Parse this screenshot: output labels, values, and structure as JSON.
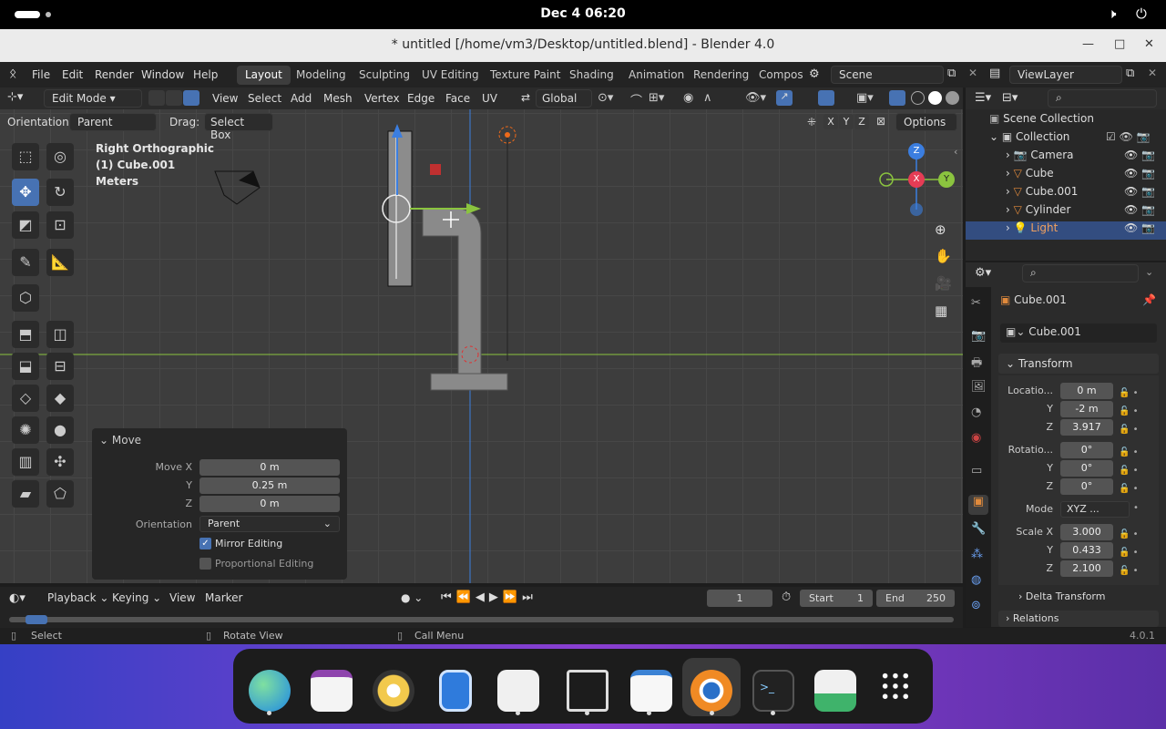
{
  "topbar": {
    "datetime": "Dec 4  06:20",
    "volume_icon": "🕨",
    "power_icon": "⏻"
  },
  "window": {
    "title": "* untitled [/home/vm3/Desktop/untitled.blend] - Blender 4.0",
    "minimize": "—",
    "maximize": "□",
    "close": "✕"
  },
  "menu": {
    "items": [
      "File",
      "Edit",
      "Render",
      "Window",
      "Help"
    ]
  },
  "workspaces": [
    "Layout",
    "Modeling",
    "Sculpting",
    "UV Editing",
    "Texture Paint",
    "Shading",
    "Animation",
    "Rendering",
    "Compos"
  ],
  "scene": {
    "name": "Scene",
    "view_layer": "ViewLayer"
  },
  "viewport_header": {
    "mode": "Edit Mode",
    "menus": [
      "View",
      "Select",
      "Add",
      "Mesh",
      "Vertex",
      "Edge",
      "Face",
      "UV"
    ],
    "transform_orientation": "Global"
  },
  "tool_settings": {
    "orientation_label": "Orientation:",
    "orientation_value": "Parent",
    "drag_label": "Drag:",
    "drag_value": "Select Box",
    "options": "Options",
    "axes": [
      "X",
      "Y",
      "Z"
    ]
  },
  "overlay": {
    "view": "Right Orthographic",
    "object": "(1) Cube.001",
    "units": "Meters"
  },
  "gizmo": {
    "z": "Z",
    "x": "X",
    "y": "Y"
  },
  "operator": {
    "title": "Move",
    "move_x_label": "Move X",
    "move_x": "0 m",
    "y_label": "Y",
    "y": "0.25 m",
    "z_label": "Z",
    "z": "0 m",
    "orientation_label": "Orientation",
    "orientation": "Parent",
    "mirror_editing": "Mirror Editing",
    "proportional_editing": "Proportional Editing"
  },
  "timeline": {
    "menus": [
      "Playback",
      "Keying",
      "View",
      "Marker"
    ],
    "current_frame": "1",
    "start_label": "Start",
    "start": "1",
    "end_label": "End",
    "end": "250"
  },
  "statusbar": {
    "select": "Select",
    "rotate": "Rotate View",
    "call_menu": "Call Menu",
    "version": "4.0.1"
  },
  "outliner": {
    "root": "Scene Collection",
    "collection": "Collection",
    "items": [
      "Camera",
      "Cube",
      "Cube.001",
      "Cylinder",
      "Light"
    ]
  },
  "properties": {
    "object_name": "Cube.001",
    "data_name": "Cube.001",
    "transform": "Transform",
    "location_label": "Locatio...",
    "loc_x": "0 m",
    "loc_y": "-2 m",
    "loc_z": "3.917",
    "rotation_label": "Rotatio...",
    "rot_x": "0°",
    "rot_y": "0°",
    "rot_z": "0°",
    "mode_label": "Mode",
    "mode": "XYZ ...",
    "scale_label": "Scale X",
    "scale_x": "3.000",
    "scale_y": "0.433",
    "scale_z": "2.100",
    "y": "Y",
    "z": "Z",
    "delta": "Delta Transform",
    "relations": "Relations"
  },
  "colors": {
    "accent": "#4772b3",
    "selected_row": "#334d80",
    "x_axis": "#e53c55",
    "y_axis": "#8bc43f",
    "z_axis": "#3b7ee0"
  }
}
